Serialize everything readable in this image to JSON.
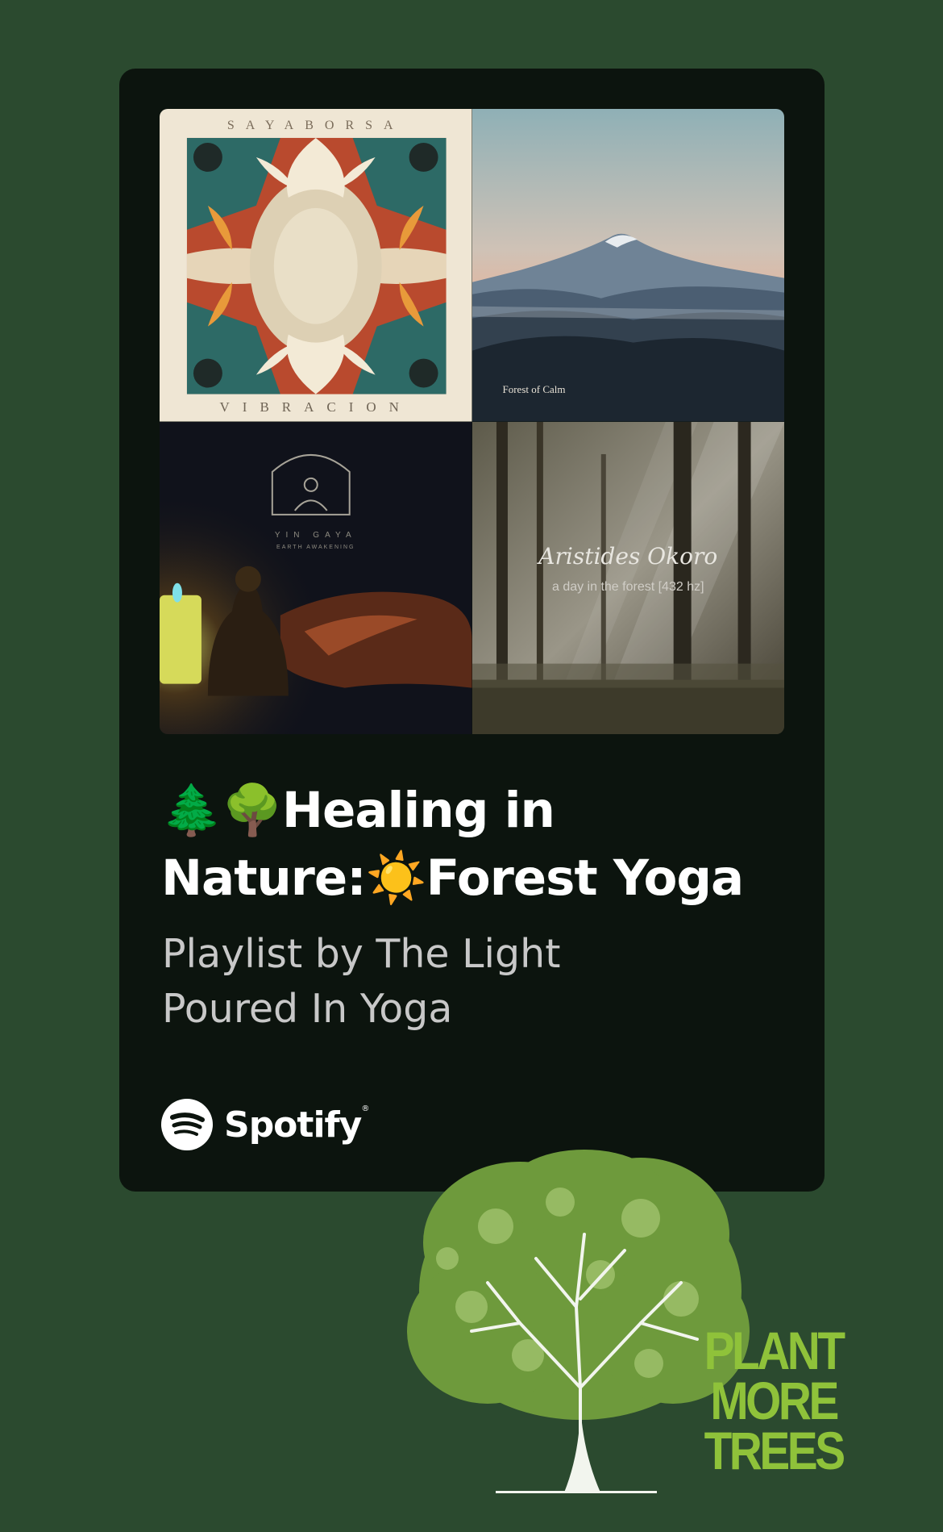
{
  "playlist": {
    "title_emoji_1": "🌲",
    "title_emoji_2": "🌳",
    "title_line1": "Healing in",
    "title_line2_a": "Nature:",
    "title_emoji_3": "☀️",
    "title_line2_b": "Forest Yoga",
    "subtitle_line1": "Playlist by The Light",
    "subtitle_line2": "Poured In Yoga"
  },
  "covers": [
    {
      "top_text": "SAYABORSA",
      "bottom_text": "VIBRACION"
    },
    {
      "label": "Forest of Calm"
    },
    {
      "brand": "YIN GAYA",
      "sub": "EARTH AWAKENING"
    },
    {
      "artist": "Aristides Okoro",
      "album": "a day in the forest [432 hz]"
    }
  ],
  "spotify": {
    "wordmark": "Spotify",
    "trademark": "®"
  },
  "promo": {
    "line1": "PLANT",
    "line2": "MORE",
    "line3": "TREES"
  },
  "colors": {
    "background": "#2b4a2f",
    "card": "#0c140e",
    "promo_green": "#8fc23a"
  }
}
